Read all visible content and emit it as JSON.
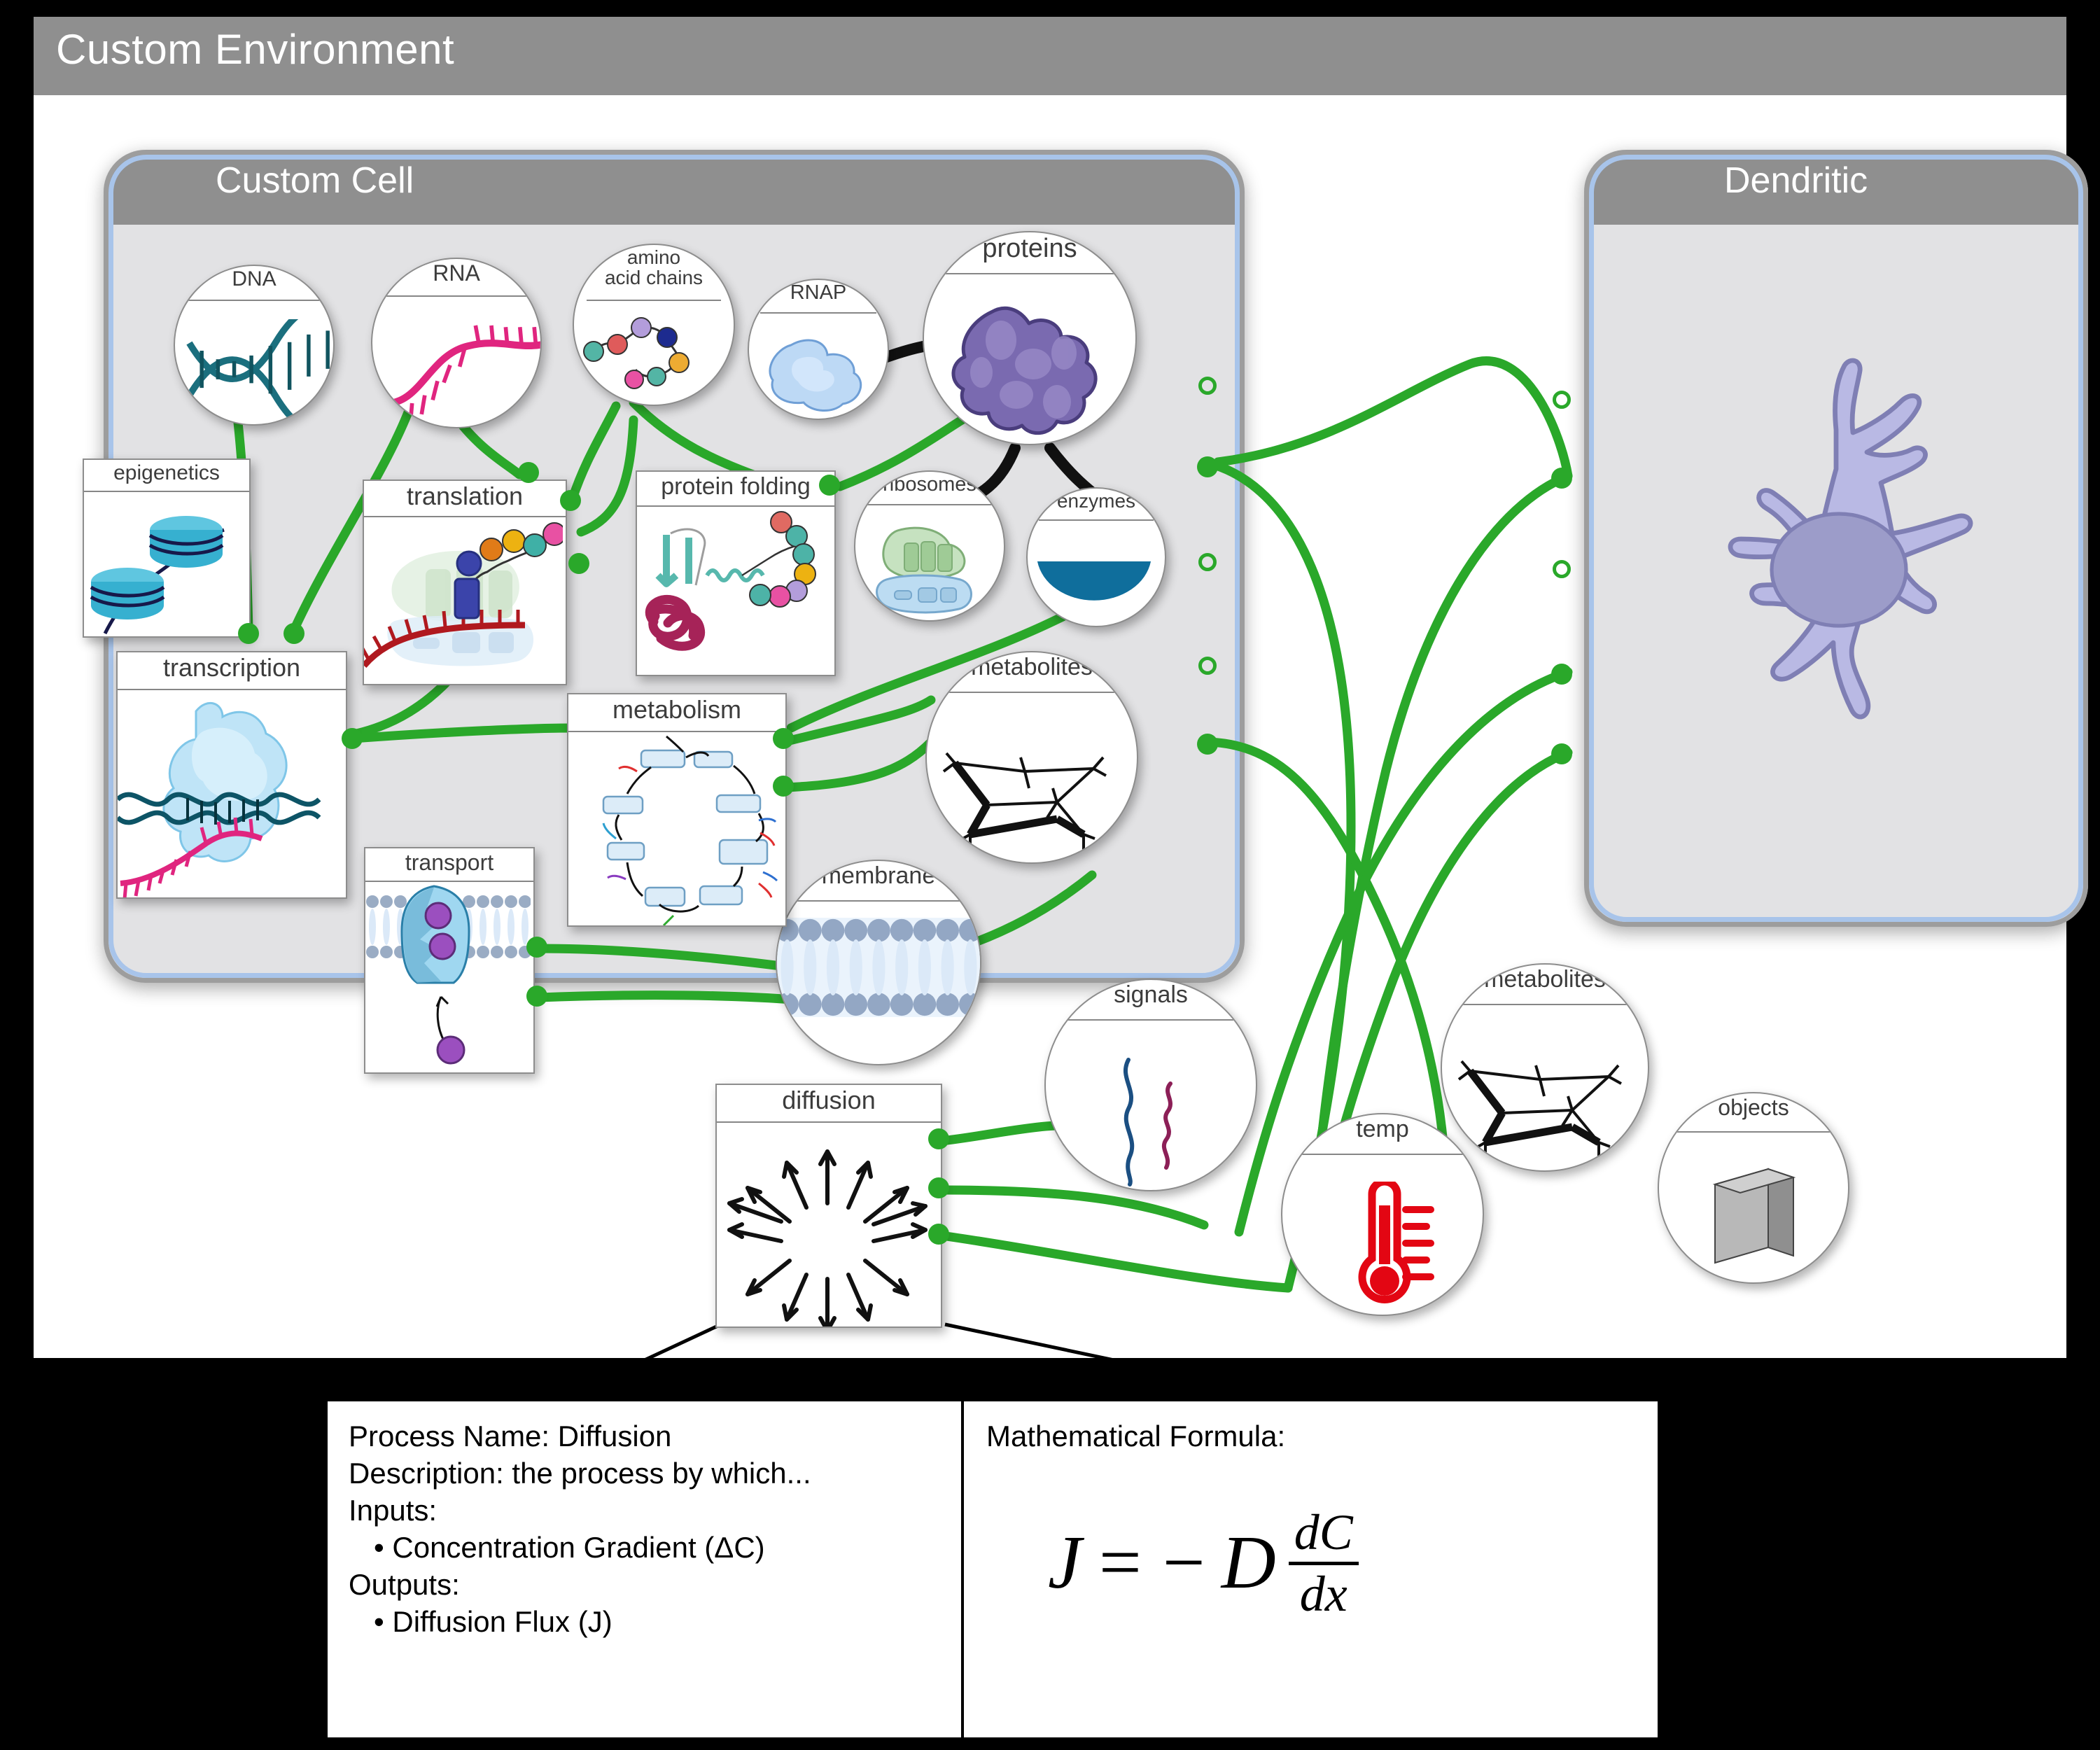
{
  "environment": {
    "title": "Custom Environment"
  },
  "compartments": [
    {
      "id": "custom-cell",
      "title": "Custom Cell"
    },
    {
      "id": "dendritic",
      "title": "Dendritic"
    }
  ],
  "nodes": [
    {
      "id": "dna",
      "label": "DNA",
      "shape": "circle",
      "kind": "store",
      "art": "dna-helix-icon"
    },
    {
      "id": "rna",
      "label": "RNA",
      "shape": "circle",
      "kind": "store",
      "art": "rna-strand-icon"
    },
    {
      "id": "amino",
      "label": "amino\nacid chains",
      "shape": "circle",
      "kind": "store",
      "art": "amino-chain-icon"
    },
    {
      "id": "rnap",
      "label": "RNAP",
      "shape": "circle",
      "kind": "store",
      "art": "rnap-blob-icon"
    },
    {
      "id": "proteins",
      "label": "proteins",
      "shape": "circle",
      "kind": "store",
      "art": "protein-blob-icon"
    },
    {
      "id": "ribosomes",
      "label": "ribosomes",
      "shape": "circle",
      "kind": "store",
      "art": "ribosome-icon"
    },
    {
      "id": "enzymes",
      "label": "enzymes",
      "shape": "circle",
      "kind": "store",
      "art": "enzyme-icon"
    },
    {
      "id": "metabolites1",
      "label": "metabolites",
      "shape": "circle",
      "kind": "store",
      "art": "molecule-skeleton-icon"
    },
    {
      "id": "membrane",
      "label": "membrane",
      "shape": "circle",
      "kind": "store",
      "art": "lipid-bilayer-icon"
    },
    {
      "id": "signals",
      "label": "signals",
      "shape": "circle",
      "kind": "store",
      "art": "signal-squiggle-icon"
    },
    {
      "id": "metabolites2",
      "label": "metabolites",
      "shape": "circle",
      "kind": "store",
      "art": "molecule-skeleton-icon"
    },
    {
      "id": "temp",
      "label": "temp",
      "shape": "circle",
      "kind": "store",
      "art": "thermometer-icon"
    },
    {
      "id": "objects",
      "label": "objects",
      "shape": "circle",
      "kind": "store",
      "art": "slab-3d-icon"
    },
    {
      "id": "epigenetics",
      "label": "epigenetics",
      "shape": "box",
      "kind": "process",
      "art": "histone-icon"
    },
    {
      "id": "translation",
      "label": "translation",
      "shape": "box",
      "kind": "process",
      "art": "translation-icon"
    },
    {
      "id": "protein-folding",
      "label": "protein folding",
      "shape": "box",
      "kind": "process",
      "art": "folding-icon"
    },
    {
      "id": "transcription",
      "label": "transcription",
      "shape": "box",
      "kind": "process",
      "art": "transcription-icon"
    },
    {
      "id": "metabolism",
      "label": "metabolism",
      "shape": "box",
      "kind": "process",
      "art": "metabolic-cycle-icon"
    },
    {
      "id": "transport",
      "label": "transport",
      "shape": "box",
      "kind": "process",
      "art": "transporter-icon"
    },
    {
      "id": "diffusion",
      "label": "diffusion",
      "shape": "box",
      "kind": "process",
      "art": "diffusion-arrows-icon"
    }
  ],
  "info_panel": {
    "process_name_line": "Process Name: Diffusion",
    "description_line": "Description: the process by which...",
    "inputs_label": "Inputs:",
    "inputs": [
      "• Concentration Gradient (ΔC)"
    ],
    "outputs_label": "Outputs:",
    "outputs": [
      "• Diffusion Flux (J)"
    ],
    "formula_label": "Mathematical Formula:",
    "formula": {
      "lhs": "J",
      "eq": "=",
      "sign": "−",
      "coef": "D",
      "num": "dC",
      "den": "dx"
    }
  },
  "colors": {
    "connection": "#2aa82a",
    "bold_link": "#000000",
    "env_header": "#8f8f8f",
    "compartment_fill": "#e2e2e4",
    "compartment_border": "#9d9d9d",
    "compartment_border_inner": "#a8c4ea",
    "node_border": "#8d8d8d",
    "temp_red": "#e30613",
    "protein_purple": "#7a6ab0",
    "dendritic_cell": "#b3b3e0"
  }
}
